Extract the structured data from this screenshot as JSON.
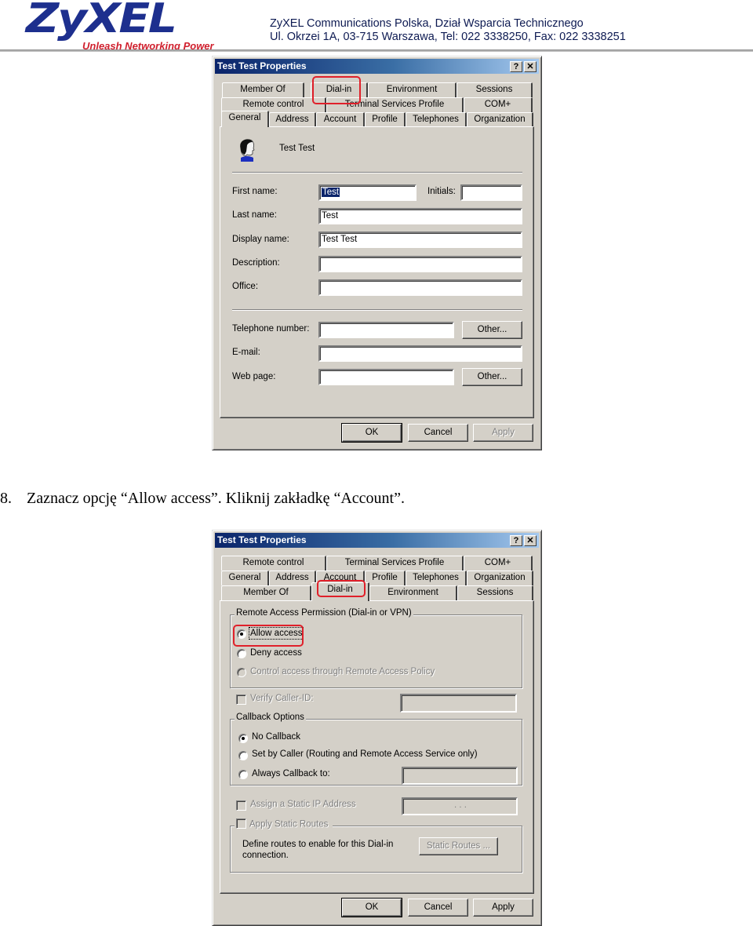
{
  "header": {
    "logo_main": "ZyXEL",
    "logo_tagline": "Unleash Networking Power",
    "company_line": "ZyXEL Communications Polska, Dział Wsparcia Technicznego",
    "address_line": "Ul. Okrzei 1A, 03-715 Warszawa, Tel:  022 3338250, Fax: 022 3338251",
    "brand_color": "#1d2f8e",
    "tagline_color": "#d0202e"
  },
  "dialog1": {
    "title": "Test Test Properties",
    "help_glyph": "?",
    "close_glyph": "✕",
    "tabs_row1": [
      "Member Of",
      "Dial-in",
      "Environment",
      "Sessions"
    ],
    "tabs_row2": [
      "Remote control",
      "Terminal Services Profile",
      "COM+"
    ],
    "tabs_row3": [
      "General",
      "Address",
      "Account",
      "Profile",
      "Telephones",
      "Organization"
    ],
    "active_tab": "General",
    "highlighted_tab": "Dial-in",
    "user_display": "Test Test",
    "fields": {
      "first_name_label": "First name:",
      "first_name_value": "Test",
      "initials_label": "Initials:",
      "initials_value": "",
      "last_name_label": "Last name:",
      "last_name_value": "Test",
      "display_name_label": "Display name:",
      "display_name_value": "Test Test",
      "description_label": "Description:",
      "description_value": "",
      "office_label": "Office:",
      "office_value": "",
      "telephone_label": "Telephone number:",
      "telephone_value": "",
      "email_label": "E-mail:",
      "email_value": "",
      "webpage_label": "Web page:",
      "webpage_value": ""
    },
    "other_button": "Other...",
    "buttons": {
      "ok": "OK",
      "cancel": "Cancel",
      "apply": "Apply"
    }
  },
  "step": {
    "number": "8.",
    "text": "Zaznacz opcję “Allow access”. Kliknij zakładkę “Account”."
  },
  "dialog2": {
    "title": "Test Test Properties",
    "help_glyph": "?",
    "close_glyph": "✕",
    "tabs_row1": [
      "Remote control",
      "Terminal Services Profile",
      "COM+"
    ],
    "tabs_row2": [
      "General",
      "Address",
      "Account",
      "Profile",
      "Telephones",
      "Organization"
    ],
    "tabs_row3": [
      "Member Of",
      "Dial-in",
      "Environment",
      "Sessions"
    ],
    "active_tab": "Dial-in",
    "highlighted_tab": "Dial-in",
    "remote_access_group": "Remote Access Permission (Dial-in or VPN)",
    "allow_access": "Allow access",
    "deny_access": "Deny access",
    "control_access": "Control access through Remote Access Policy",
    "selected_permission": "Allow access",
    "verify_caller_id": "Verify Caller-ID:",
    "verify_caller_id_value": "",
    "callback_group": "Callback Options",
    "no_callback": "No Callback",
    "set_by_caller": "Set by Caller (Routing and Remote Access Service only)",
    "always_callback": "Always Callback to:",
    "always_callback_value": "",
    "selected_callback": "No Callback",
    "assign_static_ip": "Assign a Static IP Address",
    "static_ip_value": ".       .       .",
    "apply_static_routes": "Apply Static Routes",
    "routes_description": "Define routes to enable for this Dial-in connection.",
    "static_routes_button": "Static Routes ...",
    "buttons": {
      "ok": "OK",
      "cancel": "Cancel",
      "apply": "Apply"
    }
  }
}
